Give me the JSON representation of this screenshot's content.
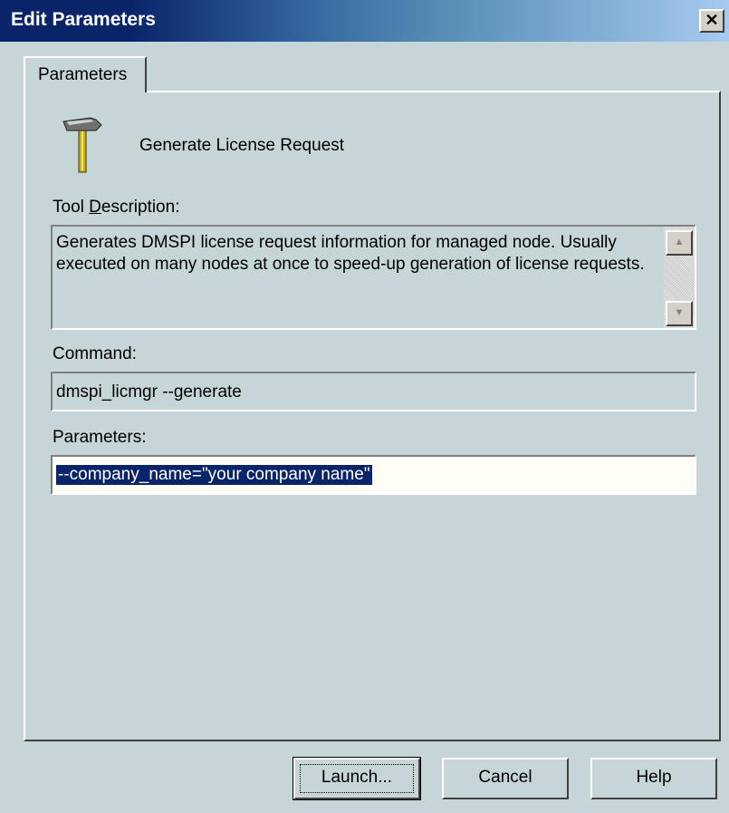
{
  "window": {
    "title": "Edit Parameters",
    "close_glyph": "✕"
  },
  "tabs": [
    {
      "label": "Parameters"
    }
  ],
  "tool": {
    "icon": "hammer-icon",
    "name": "Generate License Request"
  },
  "description": {
    "label": "Tool Description:",
    "text": "Generates DMSPI license request information for managed node. Usually executed on many nodes at once to speed-up generation of license requests."
  },
  "command": {
    "label": "Command:",
    "value": "dmspi_licmgr --generate"
  },
  "parameters": {
    "label": "Parameters:",
    "value": "--company_name=\"your company name\""
  },
  "buttons": {
    "launch": "Launch...",
    "cancel": "Cancel",
    "help": "Help"
  },
  "colors": {
    "title_bar_start": "#0a246a",
    "title_bar_end": "#a6caf0",
    "dialog_bg": "#c5d5d8",
    "selection": "#0a246a"
  }
}
